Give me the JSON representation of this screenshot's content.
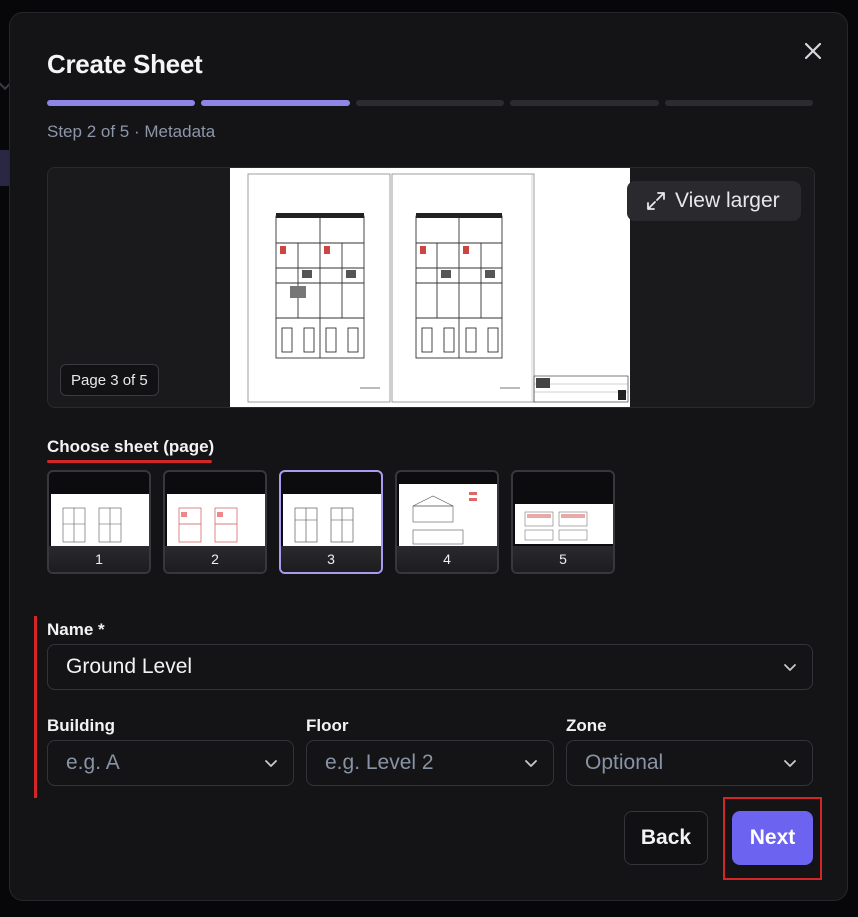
{
  "modal": {
    "title": "Create Sheet",
    "step_text": "Step 2 of 5 · Metadata",
    "progress": {
      "total_steps": 5,
      "completed_steps": 2
    },
    "accent_color": "#6c63f0"
  },
  "preview": {
    "view_larger_label": "View larger",
    "page_badge": "Page 3 of 5"
  },
  "sheet_picker": {
    "label": "Choose sheet (page)",
    "pages": [
      "1",
      "2",
      "3",
      "4",
      "5"
    ],
    "selected": "3"
  },
  "form": {
    "name_label": "Name *",
    "name_value": "Ground Level",
    "building_label": "Building",
    "building_placeholder": "e.g. A",
    "floor_label": "Floor",
    "floor_placeholder": "e.g. Level 2",
    "zone_label": "Zone",
    "zone_placeholder": "Optional"
  },
  "footer": {
    "back_label": "Back",
    "next_label": "Next"
  },
  "icons": {
    "close": "close-icon",
    "expand": "expand-icon",
    "chevron": "chevron-down-icon"
  }
}
